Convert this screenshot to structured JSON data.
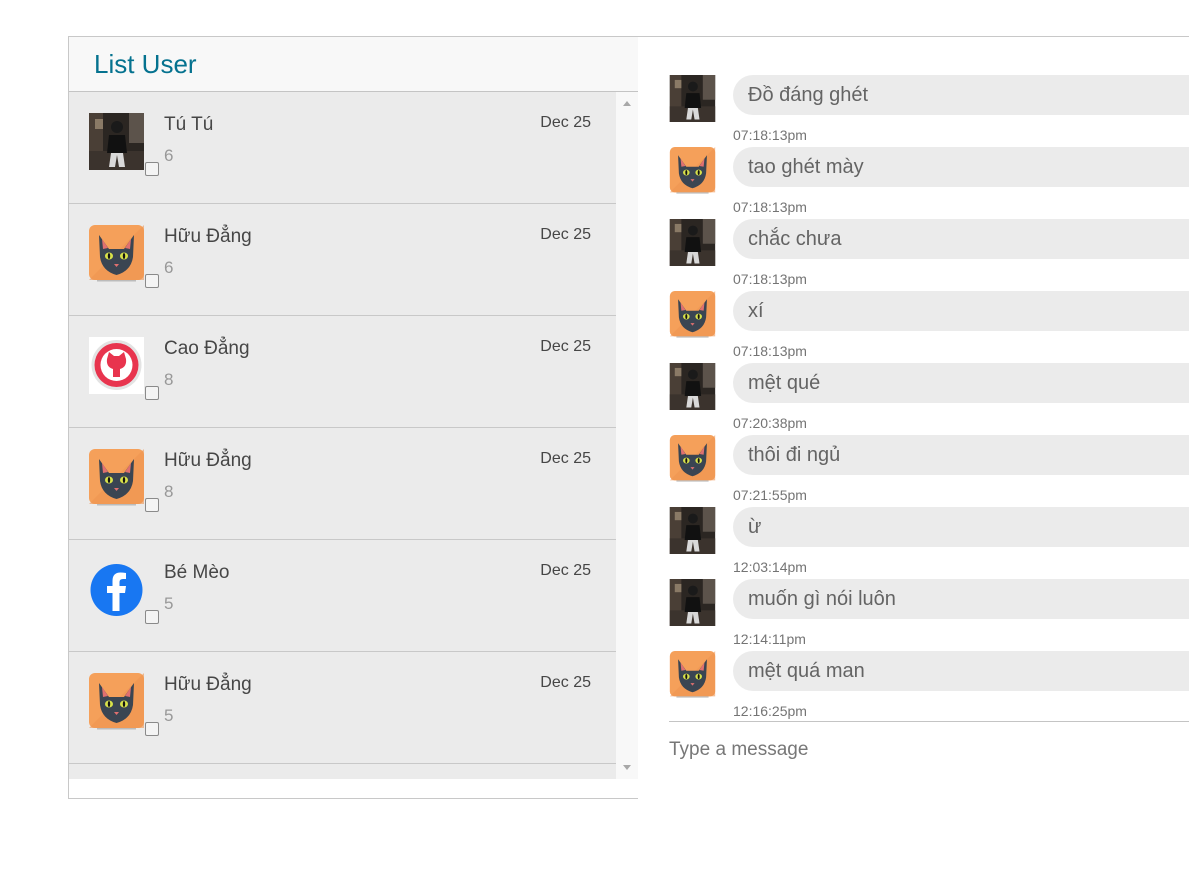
{
  "sidebar": {
    "title": "List User",
    "users": [
      {
        "name": "Tú Tú",
        "date": "Dec 25",
        "count": "6",
        "avatar": "photo-avatar"
      },
      {
        "name": "Hữu Đẳng",
        "date": "Dec 25",
        "count": "6",
        "avatar": "cat-avatar"
      },
      {
        "name": "Cao Đẳng",
        "date": "Dec 25",
        "count": "8",
        "avatar": "github-avatar"
      },
      {
        "name": "Hữu Đẳng",
        "date": "Dec 25",
        "count": "8",
        "avatar": "cat-avatar"
      },
      {
        "name": "Bé Mèo",
        "date": "Dec 25",
        "count": "5",
        "avatar": "facebook-avatar"
      },
      {
        "name": "Hữu Đẳng",
        "date": "Dec 25",
        "count": "5",
        "avatar": "cat-avatar"
      }
    ]
  },
  "chat": {
    "messages": [
      {
        "text": "Đồ đáng ghét",
        "time": "07:18:13pm",
        "avatar": "photo-avatar"
      },
      {
        "text": "tao ghét mày",
        "time": "07:18:13pm",
        "avatar": "cat-avatar"
      },
      {
        "text": "chắc chưa",
        "time": "07:18:13pm",
        "avatar": "photo-avatar"
      },
      {
        "text": "xí",
        "time": "07:18:13pm",
        "avatar": "cat-avatar"
      },
      {
        "text": "mệt qué",
        "time": "07:20:38pm",
        "avatar": "photo-avatar"
      },
      {
        "text": "thôi đi ngủ",
        "time": "07:21:55pm",
        "avatar": "cat-avatar"
      },
      {
        "text": "ừ",
        "time": "12:03:14pm",
        "avatar": "photo-avatar"
      },
      {
        "text": "muốn gì nói luôn",
        "time": "12:14:11pm",
        "avatar": "photo-avatar"
      },
      {
        "text": "mệt quá man",
        "time": "12:16:25pm",
        "avatar": "cat-avatar"
      }
    ],
    "input_placeholder": "Type a message"
  },
  "colors": {
    "title": "#05728f",
    "list_bg": "#ebebeb",
    "bubble_bg": "#ebebeb",
    "cat_bg": "#f5a05a",
    "facebook_blue": "#1877f2",
    "github_red": "#e8344e"
  }
}
